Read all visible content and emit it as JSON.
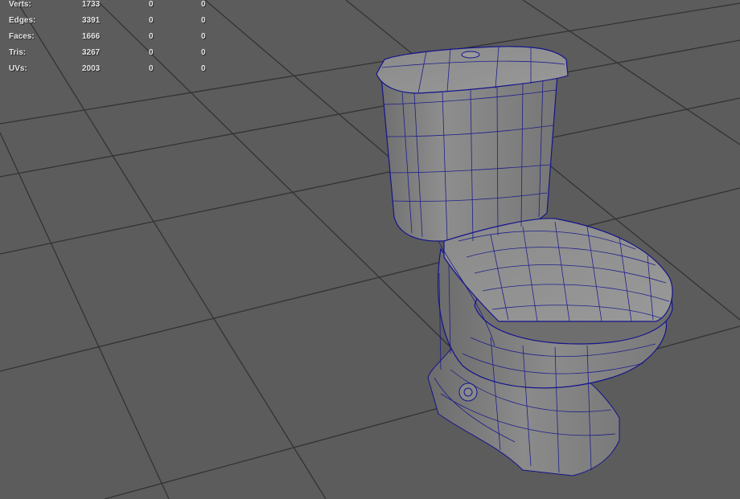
{
  "poly_count_hud": {
    "rows": [
      {
        "label": "Verts:",
        "count": "1733",
        "selected": "0",
        "component": "0"
      },
      {
        "label": "Edges:",
        "count": "3391",
        "selected": "0",
        "component": "0"
      },
      {
        "label": "Faces:",
        "count": "1666",
        "selected": "0",
        "component": "0"
      },
      {
        "label": "Tris:",
        "count": "3267",
        "selected": "0",
        "component": "0"
      },
      {
        "label": "UVs:",
        "count": "2003",
        "selected": "0",
        "component": "0"
      }
    ]
  },
  "viewport": {
    "background_color": "#5c5c5c",
    "grid_color": "#2f2f2f",
    "mesh_shade_color": "#8c8c8c",
    "wireframe_color": "#14148c"
  }
}
